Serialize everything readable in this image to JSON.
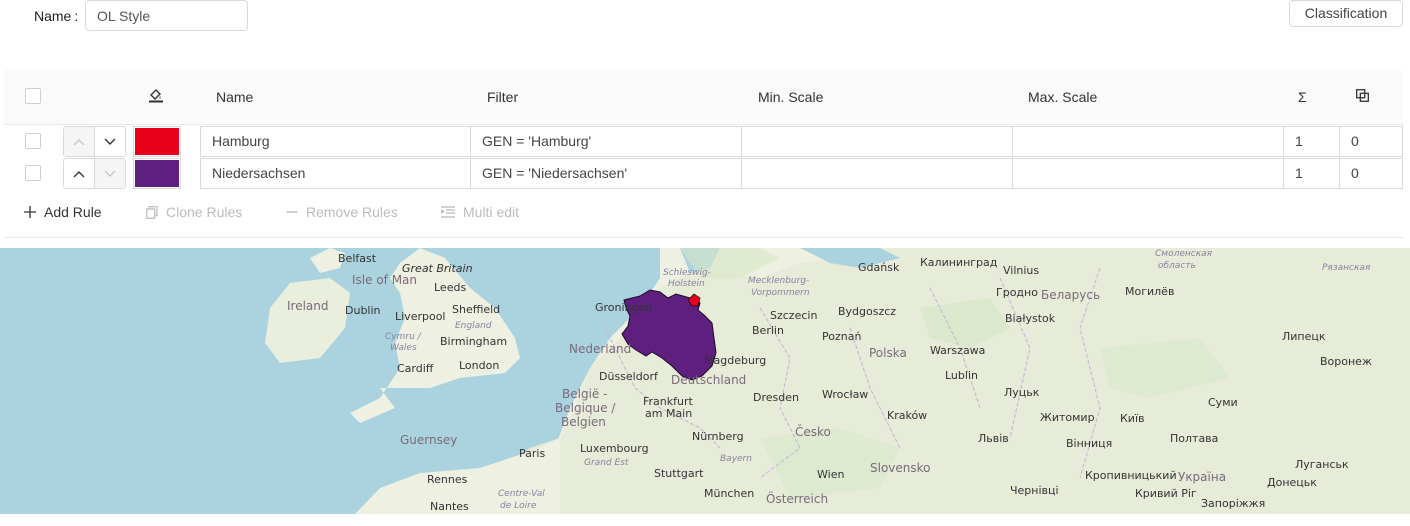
{
  "form": {
    "name_label": "Name",
    "name_colon": ":",
    "name_value": "OL Style"
  },
  "classification_label": "Classification",
  "table": {
    "headers": {
      "name": "Name",
      "filter": "Filter",
      "min_scale": "Min. Scale",
      "max_scale": "Max. Scale",
      "sigma": "Σ"
    },
    "rows": [
      {
        "name": "Hamburg",
        "color": "#e8001a",
        "filter": "GEN = 'Hamburg'",
        "min_scale": "",
        "max_scale": "",
        "count": "1",
        "overlap": "0"
      },
      {
        "name": "Niedersachsen",
        "color": "#5e1f7f",
        "filter": "GEN = 'Niedersachsen'",
        "min_scale": "",
        "max_scale": "",
        "count": "1",
        "overlap": "0"
      }
    ]
  },
  "footer": {
    "add_rule": "Add Rule",
    "clone_rules": "Clone Rules",
    "remove_rules": "Remove Rules",
    "multi_edit": "Multi edit"
  },
  "map": {
    "labels": {
      "belfast": "Belfast",
      "great_britain": "Great Britain",
      "isle_of_man": "Isle of Man",
      "leeds": "Leeds",
      "ireland": "Ireland",
      "dublin": "Dublin",
      "liverpool": "Liverpool",
      "sheffield": "Sheffield",
      "england": "England",
      "cymru": "Cymru /",
      "wales": "Wales",
      "birmingham": "Birmingham",
      "cardiff": "Cardiff",
      "london": "London",
      "guernsey": "Guernsey",
      "rennes": "Rennes",
      "nantes": "Nantes",
      "centre": "Centre-Val",
      "de_loire": "de Loire",
      "paris": "Paris",
      "grand_est": "Grand Est",
      "luxembourg": "Luxembourg",
      "stuttgart": "Stuttgart",
      "munchen": "München",
      "nurnberg": "Nürnberg",
      "bayern": "Bayern",
      "frankfurt": "Frankfurt",
      "am_main": "am Main",
      "belgie": "België -",
      "belgique": "Belgique /",
      "belgien": "Belgien",
      "nederland": "Nederland",
      "dusseldorf": "Düsseldorf",
      "groningen": "Groningen",
      "deutschland": "Deutschland",
      "magdeburg": "Magdeburg",
      "schleswig": "Schleswig-",
      "holstein": "Holstein",
      "mecklenburg": "Mecklenburg-",
      "vorpommern": "Vorpommern",
      "szczecin": "Szczecin",
      "berlin": "Berlin",
      "poznan": "Poznań",
      "dresden": "Dresden",
      "wroclaw": "Wrocław",
      "cesko": "Česko",
      "osterreich": "Österreich",
      "wien": "Wien",
      "slovensko": "Slovensko",
      "krakow": "Kraków",
      "polska": "Polska",
      "warszawa": "Warszawa",
      "bydgoszcz": "Bydgoszcz",
      "gdansk": "Gdańsk",
      "kaliningrad": "Калининград",
      "vilnius": "Vilnius",
      "grodno": "Гродно",
      "belarus": "Беларусь",
      "mogilev": "Могилёв",
      "bialystok": "Białystok",
      "lublin": "Lublin",
      "lutsk": "Луцьк",
      "lviv": "Львів",
      "zhytomyr": "Житомир",
      "kyiv": "Київ",
      "vinnytsia": "Вінниця",
      "poltava": "Полтава",
      "ukraina": "Україна",
      "kropyvnytskyi": "Кропивницький",
      "kryvyi_rih": "Кривий Ріг",
      "zaporizhzhia": "Запоріжжя",
      "chernivtsi": "Чернівці",
      "sumy": "Суми",
      "luhansk": "Луганськ",
      "donetsk": "Донецьк",
      "lipetsk": "Липецк",
      "voronezh": "Воронеж",
      "smolensk": "Смоленская",
      "ryazan": "Рязанская",
      "oblast": "область"
    }
  }
}
